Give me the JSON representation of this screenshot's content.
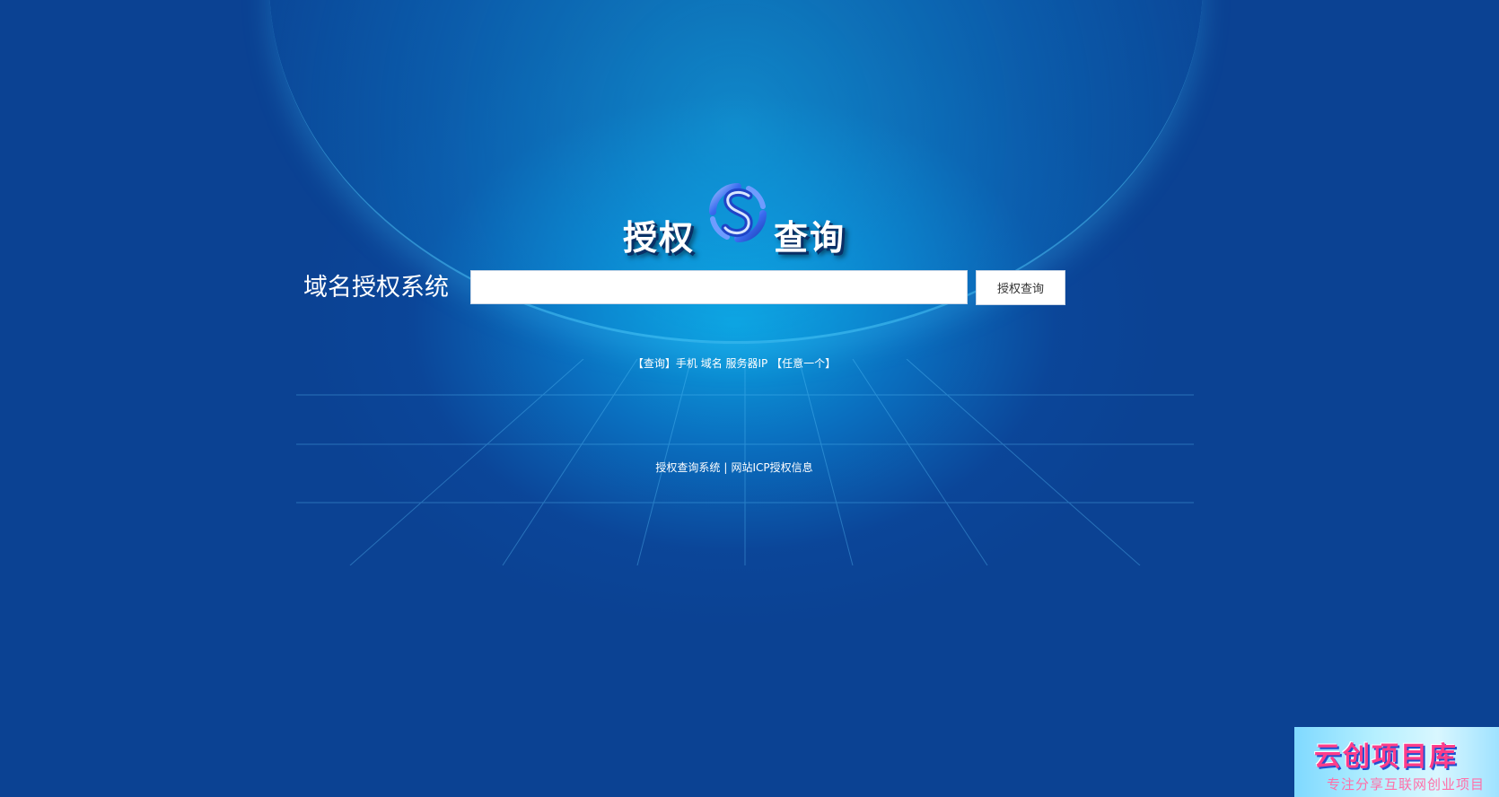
{
  "logo": {
    "left_text": "授权",
    "right_text": "查询",
    "emblem_icon": "s-swirl-emblem-icon"
  },
  "search": {
    "label": "域名授权系统",
    "value": "",
    "placeholder": "",
    "button_label": "授权查询"
  },
  "hint": "【查询】手机 域名 服务器IP 【任意一个】",
  "footer": {
    "link1": "授权查询系统",
    "separator": "|",
    "link2": "网站ICP授权信息"
  },
  "watermark": {
    "title": "云创项目库",
    "subtitle": "专注分享互联网创业项目"
  },
  "colors": {
    "background": "#0b4293",
    "glow": "#0caae6",
    "text": "#ffffff"
  }
}
